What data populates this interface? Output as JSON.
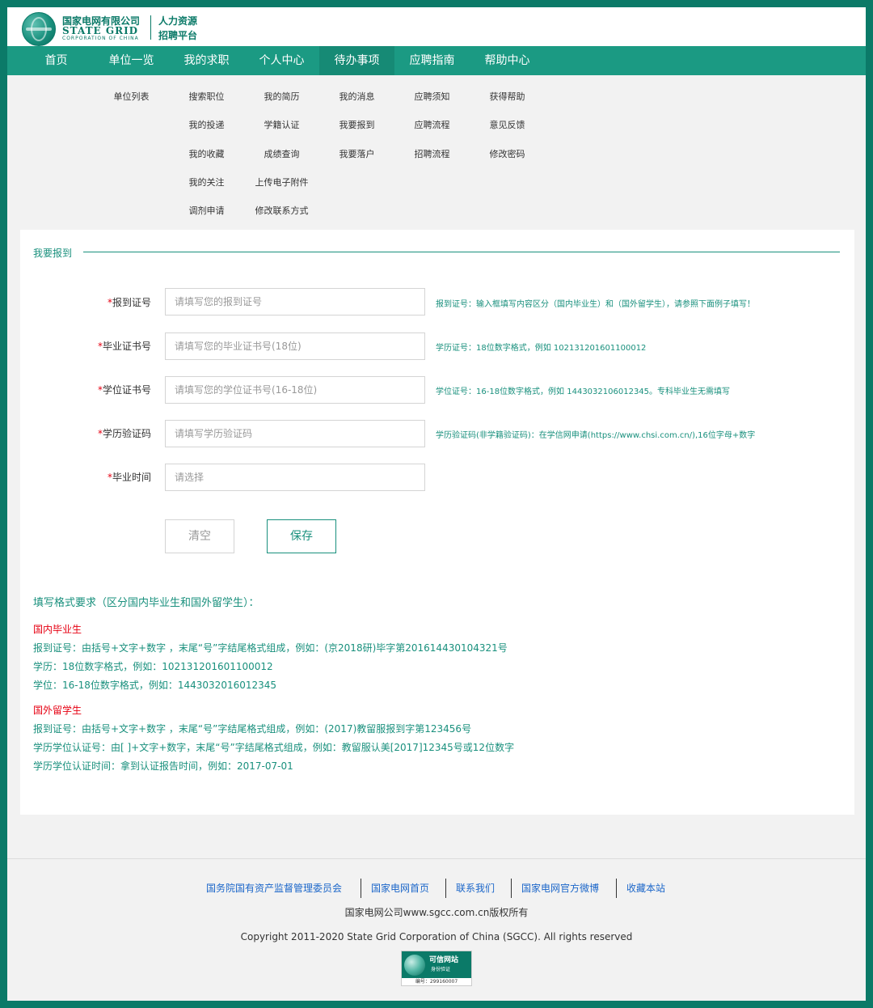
{
  "header": {
    "logo_cn": "国家电网有限公司",
    "logo_en": "STATE GRID",
    "logo_en_small": "CORPORATION OF CHINA",
    "platform_line1": "人力资源",
    "platform_line2": "招聘平台"
  },
  "nav": {
    "items": [
      {
        "label": "首页"
      },
      {
        "label": "单位一览"
      },
      {
        "label": "我的求职"
      },
      {
        "label": "个人中心"
      },
      {
        "label": "待办事项"
      },
      {
        "label": "应聘指南"
      },
      {
        "label": "帮助中心"
      }
    ],
    "active": "待办事项"
  },
  "submenu": {
    "col1": [
      "单位列表"
    ],
    "col2": [
      "搜索职位",
      "我的投递",
      "我的收藏",
      "我的关注",
      "调剂申请"
    ],
    "col3": [
      "我的简历",
      "学籍认证",
      "成绩查询",
      "上传电子附件",
      "修改联系方式"
    ],
    "col4": [
      "我的消息",
      "我要报到",
      "我要落户"
    ],
    "col5": [
      "应聘须知",
      "应聘流程",
      "招聘流程"
    ],
    "col6": [
      "获得帮助",
      "意见反馈",
      "修改密码"
    ]
  },
  "form": {
    "section_title": "我要报到",
    "fields": [
      {
        "label": "报到证号",
        "placeholder": "请填写您的报到证号",
        "hint": "报到证号：输入框填写内容区分（国内毕业生）和（国外留学生），请参照下面例子填写！"
      },
      {
        "label": "毕业证书号",
        "placeholder": "请填写您的毕业证书号(18位)",
        "hint": "学历证号：18位数字格式，例如 102131201601100012"
      },
      {
        "label": "学位证书号",
        "placeholder": "请填写您的学位证书号(16-18位)",
        "hint": "学位证号：16-18位数字格式，例如 1443032106012345。专科毕业生无需填写"
      },
      {
        "label": "学历验证码",
        "placeholder": "请填写学历验证码",
        "hint": "学历验证码(非学籍验证码)：在学信网申请(https://www.chsi.com.cn/),16位字母+数字"
      },
      {
        "label": "毕业时间",
        "placeholder": "请选择",
        "hint": ""
      }
    ],
    "required_mark": "*",
    "clear_label": "清空",
    "save_label": "保存"
  },
  "requirements": {
    "title": "填写格式要求（区分国内毕业生和国外留学生）：",
    "domestic": {
      "label": "国内毕业生",
      "lines": [
        "报到证号：由括号+文字+数字 ，末尾“号”字结尾格式组成，例如：(京2018研)毕字第201614430104321号",
        "学历：18位数字格式，例如：102131201601100012",
        "学位：16-18位数字格式，例如：1443032016012345"
      ]
    },
    "overseas": {
      "label": "国外留学生",
      "lines": [
        "报到证号：由括号+文字+数字 ，末尾“号”字结尾格式组成，例如：(2017)教留服报到字第123456号",
        "学历学位认证号：由[ ]+文字+数字，末尾“号”字结尾格式组成，例如：教留服认美[2017]12345号或12位数字",
        "学历学位认证时间：拿到认证报告时间，例如：2017-07-01"
      ]
    }
  },
  "footer": {
    "links": [
      "国务院国有资产监督管理委员会",
      "国家电网首页",
      "联系我们",
      "国家电网官方微博",
      "收藏本站"
    ],
    "copyright_cn": "国家电网公司www.sgcc.com.cn版权所有",
    "copyright_en": "Copyright 2011-2020 State Grid Corporation of China (SGCC). All rights reserved",
    "badge_title": "可信网站",
    "badge_sub": "身份验证",
    "badge_code": "编号：299160007"
  },
  "colors": {
    "brand": "#0b7a68",
    "nav": "#1b9a83",
    "accent_text": "#19907d",
    "required": "#e60012",
    "link": "#1b66c9"
  }
}
